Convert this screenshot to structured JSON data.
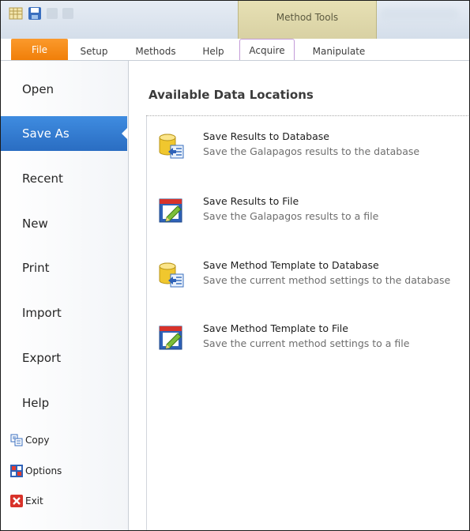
{
  "ribbon": {
    "context_group_title": "Method Tools",
    "tabs": [
      "File",
      "Setup",
      "Methods",
      "Help",
      "Acquire",
      "Manipulate"
    ]
  },
  "sidebar": {
    "items": [
      "Open",
      "Save As",
      "Recent",
      "New",
      "Print",
      "Import",
      "Export",
      "Help"
    ],
    "selected": "Save As",
    "commands": [
      {
        "label": "Copy",
        "icon": "copy-icon"
      },
      {
        "label": "Options",
        "icon": "options-icon"
      },
      {
        "label": "Exit",
        "icon": "exit-icon"
      }
    ]
  },
  "main": {
    "title": "Available Data Locations",
    "locations": [
      {
        "title": "Save Results to Database",
        "desc": "Save the Galapagos results to the database",
        "icon": "database-save-icon"
      },
      {
        "title": "Save Results to File",
        "desc": "Save the Galapagos results to a file",
        "icon": "file-save-icon"
      },
      {
        "title": "Save Method Template to Database",
        "desc": "Save the current method settings to the database",
        "icon": "database-save-icon"
      },
      {
        "title": "Save Method Template to File",
        "desc": "Save the current method settings to a file",
        "icon": "file-save-icon"
      }
    ]
  },
  "colors": {
    "file_tab": "#f07e07",
    "selected_item": "#2a6dc2",
    "context_group": "#d8d1a3"
  }
}
